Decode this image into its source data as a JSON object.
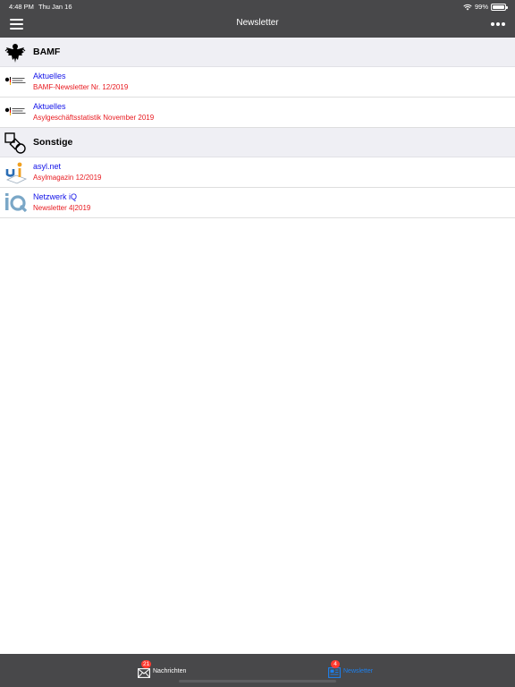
{
  "status_bar": {
    "time": "4:48 PM",
    "date": "Thu Jan 16",
    "battery": "99%",
    "battery_level": 0.99
  },
  "nav": {
    "title": "Newsletter"
  },
  "sections": [
    {
      "title": "BAMF",
      "icon": "federal-eagle-icon",
      "items": [
        {
          "title": "Aktuelles",
          "subtitle": "BAMF-Newsletter Nr. 12/2019",
          "icon": "bamf-logo-icon"
        },
        {
          "title": "Aktuelles",
          "subtitle": "Asylgeschäftsstatistik November 2019",
          "icon": "bamf-logo-icon"
        }
      ]
    },
    {
      "title": "Sonstige",
      "icon": "shapes-icon",
      "items": [
        {
          "title": "asyl.net",
          "subtitle": "Asylmagazin 12/2019",
          "icon": "asylnet-logo-icon"
        },
        {
          "title": "Netzwerk iQ",
          "subtitle": "Newsletter 4|2019",
          "icon": "netzwerk-iq-logo-icon"
        }
      ]
    }
  ],
  "tabbar": {
    "tabs": [
      {
        "label": "Nachrichten",
        "badge": "21",
        "icon": "mail-icon",
        "selected": false
      },
      {
        "label": "Newsletter",
        "badge": "4",
        "icon": "newsletter-icon",
        "selected": true
      }
    ]
  },
  "colors": {
    "bar": "#48484a",
    "link": "#1212e8",
    "subtitle": "#e8191f",
    "badge": "#ff3b30",
    "active_tab": "#1d80ee"
  }
}
